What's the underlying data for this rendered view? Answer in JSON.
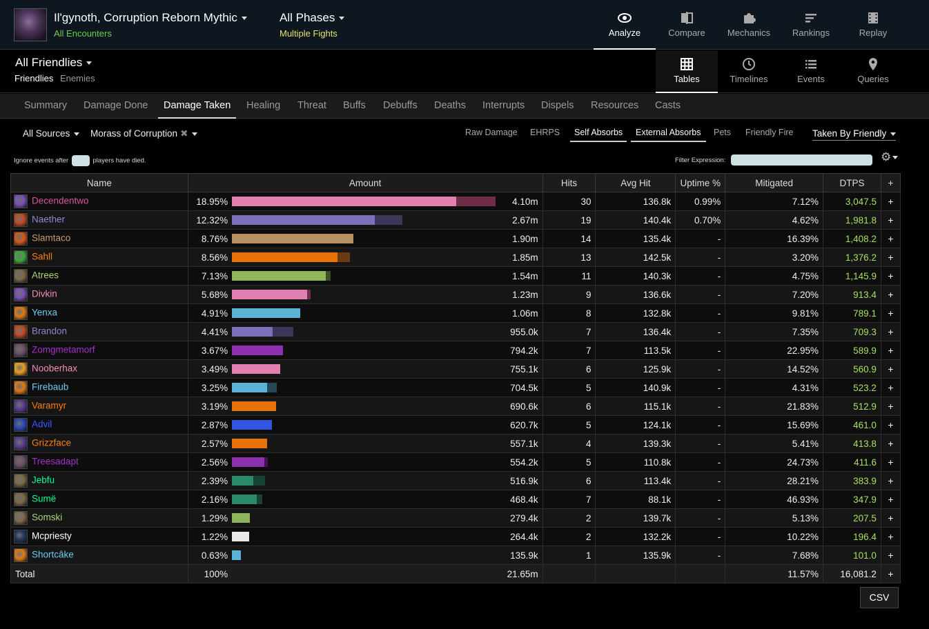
{
  "header": {
    "encounter_title": "Il'gynoth, Corruption Reborn Mythic",
    "encounter_sub": "All Encounters",
    "phase_title": "All Phases",
    "phase_sub": "Multiple Fights",
    "nav": [
      {
        "label": "Analyze",
        "icon": "eye-icon",
        "active": true
      },
      {
        "label": "Compare",
        "icon": "compare-icon",
        "active": false
      },
      {
        "label": "Mechanics",
        "icon": "puzzle-icon",
        "active": false
      },
      {
        "label": "Rankings",
        "icon": "rankings-icon",
        "active": false
      },
      {
        "label": "Replay",
        "icon": "film-icon",
        "active": false
      }
    ]
  },
  "subheader": {
    "title": "All Friendlies",
    "friendlies": "Friendlies",
    "enemies": "Enemies",
    "views": [
      {
        "label": "Tables",
        "icon": "grid-icon",
        "active": true
      },
      {
        "label": "Timelines",
        "icon": "clock-icon",
        "active": false
      },
      {
        "label": "Events",
        "icon": "list-icon",
        "active": false
      },
      {
        "label": "Queries",
        "icon": "map-pin-icon",
        "active": false
      }
    ]
  },
  "tabs": [
    "Summary",
    "Damage Done",
    "Damage Taken",
    "Healing",
    "Threat",
    "Buffs",
    "Debuffs",
    "Deaths",
    "Interrupts",
    "Dispels",
    "Resources",
    "Casts"
  ],
  "active_tab": "Damage Taken",
  "filters": {
    "sources": "All Sources",
    "ability": "Morass of Corruption",
    "options": [
      {
        "label": "Raw Damage",
        "selected": false
      },
      {
        "label": "EHRPS",
        "selected": false
      },
      {
        "label": "Self Absorbs",
        "selected": true
      },
      {
        "label": "External Absorbs",
        "selected": true
      },
      {
        "label": "Pets",
        "selected": false
      },
      {
        "label": "Friendly Fire",
        "selected": false
      }
    ],
    "taken_by": "Taken By Friendly",
    "ignore_before": "Ignore events after",
    "ignore_after": "players have died.",
    "filter_label": "Filter Expression:"
  },
  "table": {
    "headers": [
      "Name",
      "Amount",
      "Hits",
      "Avg Hit",
      "Uptime %",
      "Mitigated",
      "DTPS",
      "+"
    ],
    "rows": [
      {
        "name": "Decendentwo",
        "color": "#d9549c",
        "icon_color": "#7a4fb8",
        "pct": "18.95%",
        "main": 0.843,
        "extra": 0.147,
        "bar": "#e07fb0",
        "bar2": "#6e2e48",
        "amount": "4.10m",
        "hits": "30",
        "avg": "136.8k",
        "uptime": "0.99%",
        "mitigated": "7.12%",
        "dtps": "3,047.5"
      },
      {
        "name": "Naether",
        "color": "#8c8ad6",
        "icon_color": "#c24a20",
        "pct": "12.32%",
        "main": 0.535,
        "extra": 0.103,
        "bar": "#7f6fbb",
        "bar2": "#3c3658",
        "amount": "2.67m",
        "hits": "19",
        "avg": "140.4k",
        "uptime": "0.70%",
        "mitigated": "4.62%",
        "dtps": "1,981.8"
      },
      {
        "name": "Slamtaco",
        "color": "#c79c6e",
        "icon_color": "#d6581a",
        "pct": "8.76%",
        "main": 0.457,
        "extra": 0,
        "bar": "#b98f64",
        "bar2": "#5a4430",
        "amount": "1.90m",
        "hits": "14",
        "avg": "135.4k",
        "uptime": "-",
        "mitigated": "16.39%",
        "dtps": "1,408.2"
      },
      {
        "name": "Sahll",
        "color": "#ff7d0a",
        "icon_color": "#3fa83c",
        "pct": "8.56%",
        "main": 0.397,
        "extra": 0.047,
        "bar": "#e8720a",
        "bar2": "#6b3a10",
        "amount": "1.85m",
        "hits": "13",
        "avg": "142.5k",
        "uptime": "-",
        "mitigated": "3.20%",
        "dtps": "1,376.2"
      },
      {
        "name": "Atrees",
        "color": "#abd473",
        "icon_color": "#7b6a48",
        "pct": "7.13%",
        "main": 0.352,
        "extra": 0.018,
        "bar": "#8fb55a",
        "bar2": "#3e5028",
        "amount": "1.54m",
        "hits": "11",
        "avg": "140.3k",
        "uptime": "-",
        "mitigated": "4.75%",
        "dtps": "1,145.9"
      },
      {
        "name": "Divkin",
        "color": "#f58cba",
        "icon_color": "#7a4fb8",
        "pct": "5.68%",
        "main": 0.282,
        "extra": 0.013,
        "bar": "#e07fb0",
        "bar2": "#6e2e48",
        "amount": "1.23m",
        "hits": "9",
        "avg": "136.6k",
        "uptime": "-",
        "mitigated": "7.20%",
        "dtps": "913.4"
      },
      {
        "name": "Yenxa",
        "color": "#69ccf0",
        "icon_color": "#e07a18",
        "pct": "4.91%",
        "main": 0.256,
        "extra": 0,
        "bar": "#5ab4d8",
        "bar2": "#24485a",
        "amount": "1.06m",
        "hits": "8",
        "avg": "132.8k",
        "uptime": "-",
        "mitigated": "9.81%",
        "dtps": "789.1"
      },
      {
        "name": "Brandon",
        "color": "#9482c9",
        "icon_color": "#c24a20",
        "pct": "4.41%",
        "main": 0.154,
        "extra": 0.077,
        "bar": "#7f6fbb",
        "bar2": "#3c3658",
        "amount": "955.0k",
        "hits": "7",
        "avg": "136.4k",
        "uptime": "-",
        "mitigated": "7.35%",
        "dtps": "709.3"
      },
      {
        "name": "Zomgmetamorf",
        "color": "#a330c9",
        "icon_color": "#6a5068",
        "pct": "3.67%",
        "main": 0.192,
        "extra": 0,
        "bar": "#8e2fb0",
        "bar2": "#3f1650",
        "amount": "794.2k",
        "hits": "7",
        "avg": "113.5k",
        "uptime": "-",
        "mitigated": "22.95%",
        "dtps": "589.9"
      },
      {
        "name": "Nooberhax",
        "color": "#f58cba",
        "icon_color": "#e8a020",
        "pct": "3.49%",
        "main": 0.182,
        "extra": 0,
        "bar": "#e07fb0",
        "bar2": "#6e2e48",
        "amount": "755.1k",
        "hits": "6",
        "avg": "125.9k",
        "uptime": "-",
        "mitigated": "14.52%",
        "dtps": "560.9"
      },
      {
        "name": "Firebaub",
        "color": "#69ccf0",
        "icon_color": "#e07a18",
        "pct": "3.25%",
        "main": 0.133,
        "extra": 0.036,
        "bar": "#5ab4d8",
        "bar2": "#24485a",
        "amount": "704.5k",
        "hits": "5",
        "avg": "140.9k",
        "uptime": "-",
        "mitigated": "4.31%",
        "dtps": "523.2"
      },
      {
        "name": "Varamyr",
        "color": "#ff7d0a",
        "icon_color": "#5a3a8c",
        "pct": "3.19%",
        "main": 0.167,
        "extra": 0,
        "bar": "#e8720a",
        "bar2": "#6b3a10",
        "amount": "690.6k",
        "hits": "6",
        "avg": "115.1k",
        "uptime": "-",
        "mitigated": "21.83%",
        "dtps": "512.9"
      },
      {
        "name": "Advil",
        "color": "#3b5cff",
        "icon_color": "#2848b8",
        "pct": "2.87%",
        "main": 0.151,
        "extra": 0,
        "bar": "#2e56e0",
        "bar2": "#172a66",
        "amount": "620.7k",
        "hits": "5",
        "avg": "124.1k",
        "uptime": "-",
        "mitigated": "15.69%",
        "dtps": "461.0"
      },
      {
        "name": "Grizzface",
        "color": "#ff7d0a",
        "icon_color": "#5a3a8c",
        "pct": "2.57%",
        "main": 0.133,
        "extra": 0,
        "bar": "#e8720a",
        "bar2": "#6b3a10",
        "amount": "557.1k",
        "hits": "4",
        "avg": "139.3k",
        "uptime": "-",
        "mitigated": "5.41%",
        "dtps": "413.8"
      },
      {
        "name": "Treesadapt",
        "color": "#a330c9",
        "icon_color": "#6a5068",
        "pct": "2.56%",
        "main": 0.121,
        "extra": 0.013,
        "bar": "#8e2fb0",
        "bar2": "#3f1650",
        "amount": "554.2k",
        "hits": "5",
        "avg": "110.8k",
        "uptime": "-",
        "mitigated": "24.73%",
        "dtps": "411.6"
      },
      {
        "name": "Jebfu",
        "color": "#00ff96",
        "icon_color": "#7b6a48",
        "pct": "2.39%",
        "main": 0.08,
        "extra": 0.044,
        "bar": "#2a8a68",
        "bar2": "#154433",
        "amount": "516.9k",
        "hits": "6",
        "avg": "113.4k",
        "uptime": "-",
        "mitigated": "28.21%",
        "dtps": "383.9"
      },
      {
        "name": "Sumë",
        "color": "#00ff96",
        "icon_color": "#7b6a48",
        "pct": "2.16%",
        "main": 0.092,
        "extra": 0.021,
        "bar": "#2a8a68",
        "bar2": "#154433",
        "amount": "468.4k",
        "hits": "7",
        "avg": "88.1k",
        "uptime": "-",
        "mitigated": "46.93%",
        "dtps": "347.9"
      },
      {
        "name": "Somski",
        "color": "#abd473",
        "icon_color": "#7b6a48",
        "pct": "1.29%",
        "main": 0.068,
        "extra": 0,
        "bar": "#8fb55a",
        "bar2": "#3e5028",
        "amount": "279.4k",
        "hits": "2",
        "avg": "139.7k",
        "uptime": "-",
        "mitigated": "5.13%",
        "dtps": "207.5"
      },
      {
        "name": "Mcpriesty",
        "color": "#ffffff",
        "icon_color": "#20345a",
        "pct": "1.22%",
        "main": 0.064,
        "extra": 0,
        "bar": "#e8e8e8",
        "bar2": "#555555",
        "amount": "264.4k",
        "hits": "2",
        "avg": "132.2k",
        "uptime": "-",
        "mitigated": "10.22%",
        "dtps": "196.4"
      },
      {
        "name": "Shortcâke",
        "color": "#69ccf0",
        "icon_color": "#e07a18",
        "pct": "0.63%",
        "main": 0.033,
        "extra": 0,
        "bar": "#5ab4d8",
        "bar2": "#24485a",
        "amount": "135.9k",
        "hits": "1",
        "avg": "135.9k",
        "uptime": "-",
        "mitigated": "7.68%",
        "dtps": "101.0"
      }
    ],
    "total": {
      "label": "Total",
      "pct": "100%",
      "amount": "21.65m",
      "mitigated": "11.57%",
      "dtps": "16,081.2"
    }
  },
  "csv_label": "CSV"
}
